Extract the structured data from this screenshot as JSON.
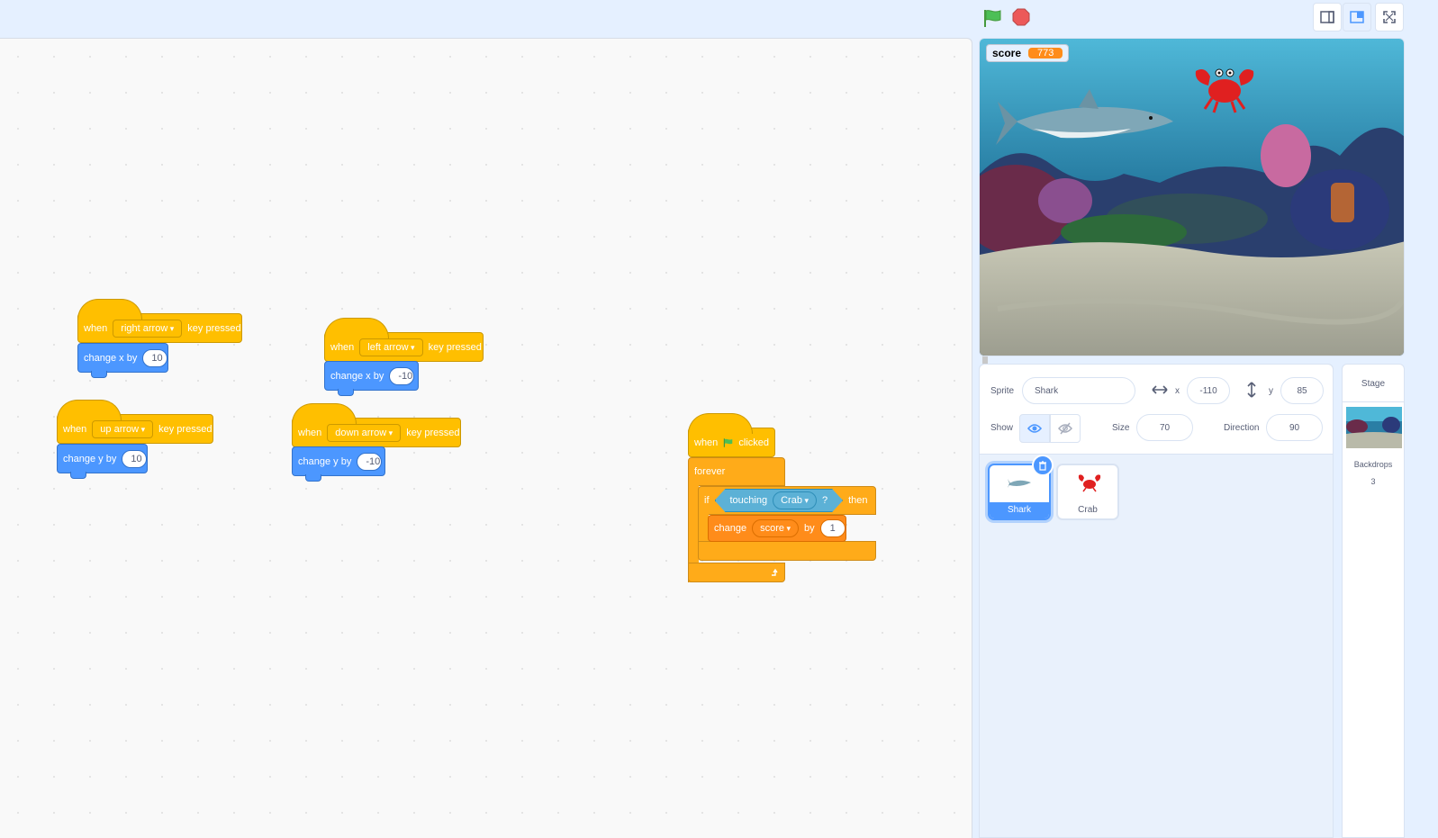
{
  "colors": {
    "events": "#ffbf00",
    "motion": "#4c97ff",
    "control": "#ffab19",
    "sensing": "#5cb1d6",
    "variables": "#ff8c1a",
    "accent": "#4c97ff"
  },
  "scripts": {
    "s1": {
      "when": "when",
      "key": "right arrow",
      "pressed": "key pressed",
      "action": "change x by",
      "value": "10"
    },
    "s2": {
      "when": "when",
      "key": "left arrow",
      "pressed": "key pressed",
      "action": "change x by",
      "value": "-10"
    },
    "s3": {
      "when": "when",
      "key": "up arrow",
      "pressed": "key pressed",
      "action": "change y by",
      "value": "10"
    },
    "s4": {
      "when": "when",
      "key": "down arrow",
      "pressed": "key pressed",
      "action": "change y by",
      "value": "-10"
    },
    "s5": {
      "when": "when",
      "clicked": "clicked",
      "forever": "forever",
      "if": "if",
      "touching": "touching",
      "target": "Crab",
      "question": "?",
      "then": "then",
      "change": "change",
      "variable": "score",
      "by": "by",
      "amount": "1"
    }
  },
  "stage": {
    "monitor_label": "score",
    "monitor_value": "773"
  },
  "sprite_info": {
    "sprite_label": "Sprite",
    "sprite_name": "Shark",
    "x_label": "x",
    "x_value": "-110",
    "y_label": "y",
    "y_value": "85",
    "show_label": "Show",
    "size_label": "Size",
    "size_value": "70",
    "direction_label": "Direction",
    "direction_value": "90"
  },
  "sprites": [
    {
      "name": "Shark"
    },
    {
      "name": "Crab"
    }
  ],
  "stage_panel": {
    "title": "Stage",
    "backdrops_label": "Backdrops",
    "backdrops_count": "3"
  }
}
